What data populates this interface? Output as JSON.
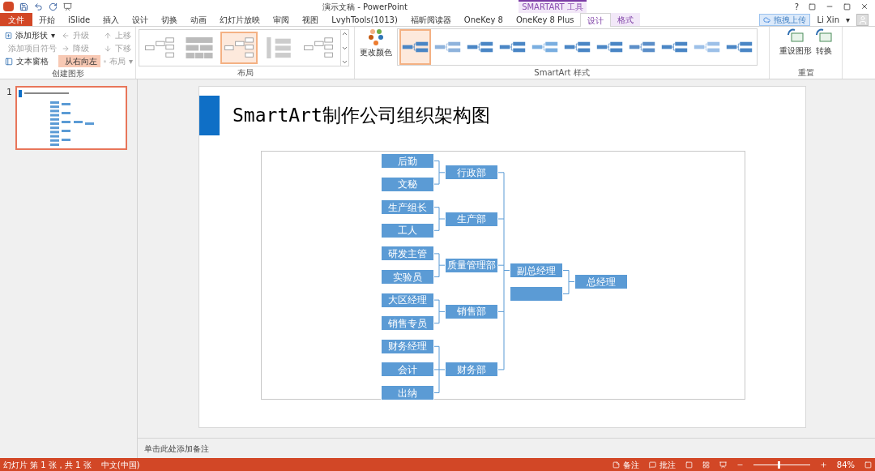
{
  "window": {
    "title": "演示文稿 - PowerPoint",
    "help": "?",
    "upload_button": "拖拽上传",
    "user": "Li Xin",
    "user_caret": "▾"
  },
  "context_tab_label": "SMARTART 工具",
  "tabs": [
    {
      "label": "文件",
      "kind": "file",
      "selected": false
    },
    {
      "label": "开始",
      "kind": "tab",
      "selected": false
    },
    {
      "label": "iSlide",
      "kind": "tab",
      "selected": false
    },
    {
      "label": "插入",
      "kind": "tab",
      "selected": false
    },
    {
      "label": "设计",
      "kind": "tab",
      "selected": false
    },
    {
      "label": "切换",
      "kind": "tab",
      "selected": false
    },
    {
      "label": "动画",
      "kind": "tab",
      "selected": false
    },
    {
      "label": "幻灯片放映",
      "kind": "tab",
      "selected": false
    },
    {
      "label": "审阅",
      "kind": "tab",
      "selected": false
    },
    {
      "label": "视图",
      "kind": "tab",
      "selected": false
    },
    {
      "label": "LvyhTools(1013)",
      "kind": "tab",
      "selected": false
    },
    {
      "label": "福昕阅读器",
      "kind": "tab",
      "selected": false
    },
    {
      "label": "OneKey 8",
      "kind": "tab",
      "selected": false
    },
    {
      "label": "OneKey 8 Plus",
      "kind": "tab",
      "selected": false
    },
    {
      "label": "设计",
      "kind": "context",
      "selected": true
    },
    {
      "label": "格式",
      "kind": "context",
      "selected": false
    }
  ],
  "ribbon": {
    "create_group": {
      "label": "创建图形",
      "columns": [
        [
          {
            "label": "添加形状",
            "caret": "▾",
            "disabled": false,
            "selected": false
          },
          {
            "label": "添加项目符号",
            "disabled": true,
            "selected": false
          },
          {
            "label": "文本窗格",
            "disabled": false,
            "selected": false
          }
        ],
        [
          {
            "label": "升级",
            "disabled": true,
            "selected": false
          },
          {
            "label": "降级",
            "disabled": true,
            "selected": false
          },
          {
            "label": "从右向左",
            "disabled": false,
            "selected": true
          }
        ],
        [
          {
            "label": "上移",
            "disabled": true,
            "selected": false
          },
          {
            "label": "下移",
            "disabled": true,
            "selected": false
          },
          {
            "label": "布局",
            "caret": "▾",
            "disabled": true,
            "selected": false
          }
        ]
      ]
    },
    "layout_group": {
      "label": "布局",
      "options": [
        {
          "selected": false
        },
        {
          "selected": false
        },
        {
          "selected": true
        },
        {
          "selected": false
        },
        {
          "selected": false
        }
      ]
    },
    "color_button": "更改颜色",
    "style_group": {
      "label": "SmartArt 样式",
      "options": [
        {
          "selected": true
        },
        {
          "selected": false
        },
        {
          "selected": false
        },
        {
          "selected": false
        },
        {
          "selected": false
        },
        {
          "selected": false
        },
        {
          "selected": false
        },
        {
          "selected": false
        },
        {
          "selected": false
        },
        {
          "selected": false
        },
        {
          "selected": false
        }
      ]
    },
    "reset_group": {
      "label": "重置",
      "buttons": [
        "重设图形",
        "转换"
      ]
    }
  },
  "slides_pane": {
    "slides": [
      {
        "number": "1",
        "selected": true
      }
    ]
  },
  "slide": {
    "title": "SmartArt制作公司组织架构图",
    "org_chart": {
      "top": "总经理",
      "deputies": [
        {
          "kind": "labeled",
          "label": "副总经理"
        },
        {
          "kind": "blank"
        }
      ],
      "departments": [
        {
          "name": "行政部",
          "members": [
            "后勤",
            "文秘"
          ]
        },
        {
          "name": "生产部",
          "members": [
            "生产组长",
            "工人"
          ]
        },
        {
          "name": "质量管理部",
          "members": [
            "研发主管",
            "实验员"
          ]
        },
        {
          "name": "销售部",
          "members": [
            "大区经理",
            "销售专员"
          ]
        },
        {
          "name": "财务部",
          "members": [
            "财务经理",
            "会计",
            "出纳"
          ]
        }
      ]
    }
  },
  "notes": {
    "placeholder": "单击此处添加备注"
  },
  "status_bar": {
    "slide_info": "幻灯片 第 1 张，共 1 张",
    "language": "中文(中国)",
    "notes_button": "备注",
    "comments_button": "批注",
    "zoom": "84%",
    "zoom_slider": {
      "level": 0.45
    }
  }
}
